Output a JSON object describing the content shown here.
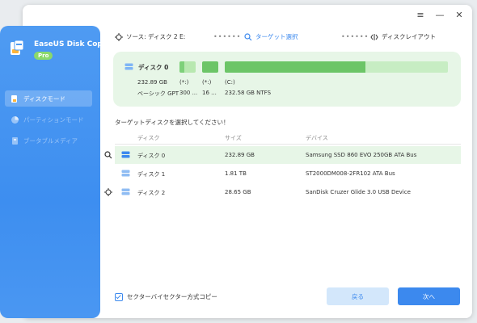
{
  "window": {
    "controls": {
      "menu": "≡",
      "minimize": "—",
      "close": "✕"
    }
  },
  "sidebar": {
    "brand_name": "EaseUS Disk Copy",
    "brand_badge": "Pro",
    "items": [
      {
        "label": "ディスクモード",
        "state": "active"
      },
      {
        "label": "パーティションモード",
        "state": "disabled"
      },
      {
        "label": "ブータブルメディア",
        "state": "disabled"
      }
    ]
  },
  "steps": {
    "source": "ソース: ディスク 2 E:",
    "target": "ターゲット選択",
    "layout": "ディスクレイアウト",
    "dots": "••••••"
  },
  "disk_panel": {
    "name": "ディスク 0",
    "size": "232.89 GB",
    "type": "ベーシック GPT",
    "partitions": [
      {
        "letter": "(*:)",
        "info": "300 ..."
      },
      {
        "letter": "(*:)",
        "info": "16 ..."
      },
      {
        "letter": "(C:)",
        "info": "232.58 GB NTFS"
      }
    ]
  },
  "prompt": "ターゲットディスクを選択してください！",
  "table": {
    "headers": [
      "ディスク",
      "サイズ",
      "デバイス"
    ],
    "rows": [
      {
        "disk": "ディスク 0",
        "size": "232.89 GB",
        "device": "Samsung SSD 860 EVO 250GB ATA Bus",
        "selected": true,
        "marker": "target-icon"
      },
      {
        "disk": "ディスク 1",
        "size": "1.81 TB",
        "device": "ST2000DM008-2FR102 ATA Bus",
        "selected": false,
        "marker": ""
      },
      {
        "disk": "ディスク 2",
        "size": "28.65 GB",
        "device": "SanDisk Cruzer Glide 3.0 USB Device",
        "selected": false,
        "marker": "source-icon"
      }
    ]
  },
  "sector_copy": {
    "label": "セクターバイセクター方式コピー",
    "checked": true
  },
  "buttons": {
    "back": "戻る",
    "next": "次へ"
  },
  "colors": {
    "accent": "#3c89ee",
    "sidebar": "#4a97f2",
    "panel": "#e7f6e7",
    "bar": "#6cc567"
  }
}
